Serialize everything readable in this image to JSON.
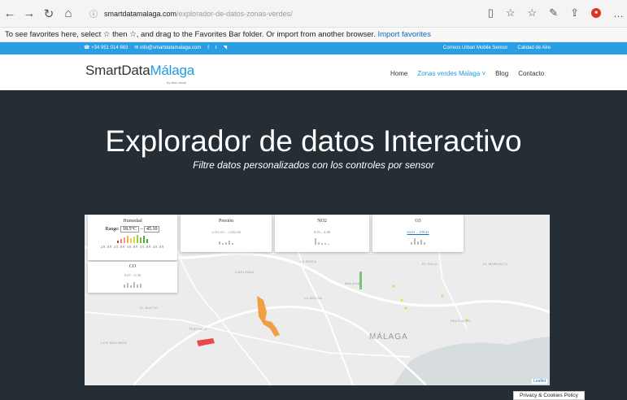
{
  "browser": {
    "url_host": "smartdatamalaga.com",
    "url_path": "/explorador-de-datos-zonas-verdes/"
  },
  "favorites_bar": {
    "message": "To see favorites here, select ☆ then ☆, and drag to the Favorites Bar folder. Or import from another browser.",
    "link": "Import favorites"
  },
  "top_strip": {
    "phone": "+34 951 014 663",
    "email": "info@smartdatamalaga.com",
    "links": [
      "Correos Urban Mobile Sensor",
      "Calidad de Aire"
    ]
  },
  "header": {
    "logo_main": "SmartData",
    "logo_accent": "Málaga",
    "logo_sub": "by altai visual",
    "menu": [
      "Home",
      "Zonas verdes Malaga ˅",
      "Blog",
      "Contacto"
    ]
  },
  "hero": {
    "title": "Explorador de datos Interactivo",
    "subtitle": "Filtre datos personalizados con los controles por sensor"
  },
  "sensors": {
    "humedad": {
      "title": "Humedad",
      "range_label": "Range:",
      "min": "18.5°C",
      "max": "45.10",
      "ticks": "20.00  25.00  30.00  35.00  40.00"
    },
    "presion": {
      "title": "Presión",
      "range": "1,011.63 – 1,022.66"
    },
    "no2": {
      "title": "NO2",
      "range": "0.03 – 4.08"
    },
    "o3": {
      "title": "O3",
      "range": "63.01 – 159.41"
    },
    "co": {
      "title": "CO",
      "range": "0.07 – 0.30"
    }
  },
  "map": {
    "city": "MÁLAGA",
    "attribution": "Leaflet",
    "labels": [
      "CARLINDA",
      "LA ROCA",
      "EL PALO",
      "MALAGA",
      "LA BOLSA",
      "EL MORLACO",
      "EL BULTO",
      "PALO ALTO",
      "TEATINOS",
      "LOS MOLINOS"
    ]
  },
  "cookies": "Privacy & Cookies Policy"
}
